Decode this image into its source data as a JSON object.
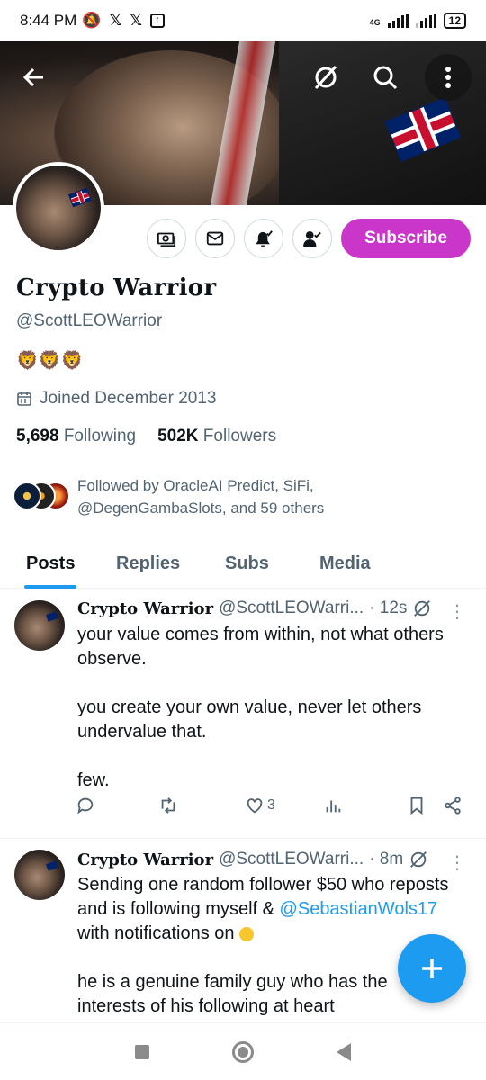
{
  "status_bar": {
    "time": "8:44 PM",
    "network": "4G",
    "battery": "12"
  },
  "profile": {
    "display_name": "Crypto Warrior",
    "handle": "@ScottLEOWarrior",
    "bio": "🦁🦁🦁",
    "joined": "Joined December 2013",
    "following_count": "5,698",
    "following_label": "Following",
    "followers_count": "502K",
    "followers_label": "Followers",
    "followed_by": "Followed by OracleAI Predict, SiFi, @DegenGambaSlots, and 59 others",
    "subscribe_label": "Subscribe"
  },
  "tabs": [
    {
      "label": "Posts",
      "active": true
    },
    {
      "label": "Replies",
      "active": false
    },
    {
      "label": "Subs",
      "active": false
    },
    {
      "label": "Media",
      "active": false
    }
  ],
  "posts": [
    {
      "name": "Crypto Warrior",
      "handle": "@ScottLEOWarri...",
      "time": "· 12s",
      "paragraphs": [
        "your value comes from within, not what others observe.",
        "you create your own value, never let others undervalue that.",
        "few."
      ],
      "likes": "3"
    },
    {
      "name": "Crypto Warrior",
      "handle": "@ScottLEOWarri...",
      "time": "· 8m",
      "line1": "Sending one random follower $50 who reposts and is following myself &",
      "mention": "@SebastianWols17",
      "line1_end": "with notifications on",
      "line2": "he is a genuine family guy who has the",
      "line3": "interests of his following at heart"
    }
  ],
  "icons": {
    "back": "arrow-left-icon",
    "grok": "grok-icon",
    "search": "search-icon",
    "more": "more-vertical-icon",
    "tip": "money-icon",
    "message": "envelope-icon",
    "notify": "bell-check-icon",
    "follow": "user-check-icon",
    "compose": "plus-icon"
  },
  "colors": {
    "accent": "#1d9bf0",
    "subscribe": "#c936c9",
    "muted": "#536471"
  }
}
